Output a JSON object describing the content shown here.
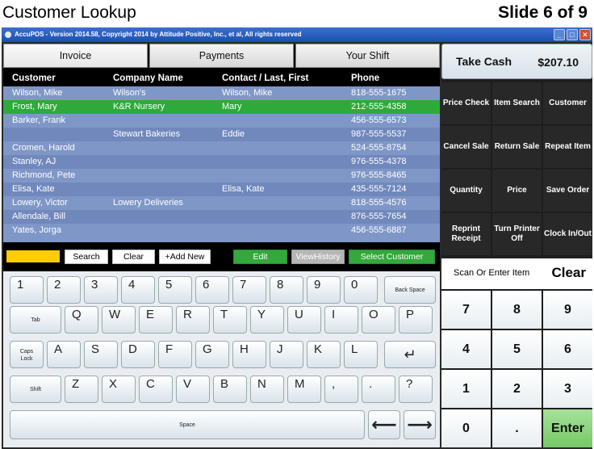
{
  "slide": {
    "title": "Customer Lookup",
    "counter": "Slide 6 of 9"
  },
  "window": {
    "title": "AccuPOS - Version 2014.58, Copyright 2014 by Attitude Positive, Inc., et al, All rights reserved",
    "minimize": "_",
    "maximize": "□",
    "close": "✕"
  },
  "tabs": [
    "Invoice",
    "Payments",
    "Your Shift"
  ],
  "table": {
    "headers": [
      "Customer",
      "Company Name",
      "Contact / Last, First",
      "Phone"
    ],
    "rows": [
      [
        "Wilson, Mike",
        "Wilson's",
        "Wilson, Mike",
        "818-555-1675"
      ],
      [
        "Frost, Mary",
        "K&R Nursery",
        "Mary",
        "212-555-4358"
      ],
      [
        "Barker, Frank",
        "",
        "",
        "456-555-6573"
      ],
      [
        "",
        "Stewart Bakeries",
        "Eddie",
        "987-555-5537"
      ],
      [
        "Cromen, Harold",
        "",
        "",
        "524-555-8754"
      ],
      [
        "Stanley, AJ",
        "",
        "",
        "976-555-4378"
      ],
      [
        "Richmond, Pete",
        "",
        "",
        "976-555-8465"
      ],
      [
        "Elisa, Kate",
        "",
        "Elisa, Kate",
        "435-555-7124"
      ],
      [
        "Lowery, Victor",
        "Lowery Deliveries",
        "",
        "818-555-4576"
      ],
      [
        "Allendale, Bill",
        "",
        "",
        "876-555-7654"
      ],
      [
        "Yates, Jorga",
        "",
        "",
        "456-555-6887"
      ]
    ],
    "selected_row": 1
  },
  "actions": {
    "search": "Search",
    "clear": "Clear",
    "add_new": "+Add New",
    "edit": "Edit",
    "view_history": "ViewHistory",
    "select_customer": "Select Customer"
  },
  "keyboard": {
    "row1": [
      "1",
      "2",
      "3",
      "4",
      "5",
      "6",
      "7",
      "8",
      "9",
      "0"
    ],
    "backspace": "Back Space",
    "tab": "Tab",
    "row2": [
      "Q",
      "W",
      "E",
      "R",
      "T",
      "Y",
      "U",
      "I",
      "O",
      "P"
    ],
    "caps": "Caps\nLock",
    "row3": [
      "A",
      "S",
      "D",
      "F",
      "G",
      "H",
      "J",
      "K",
      "L"
    ],
    "enter_icon": "return-arrow-icon",
    "shift": "Shift",
    "row4": [
      "Z",
      "X",
      "C",
      "V",
      "B",
      "N",
      "M",
      ",",
      ".",
      "?"
    ],
    "space": "Space",
    "left_icon": "arrow-left-icon",
    "right_icon": "arrow-right-icon"
  },
  "take_cash": {
    "label": "Take Cash",
    "amount": "$207.10"
  },
  "functions": [
    "Price Check",
    "Item Search",
    "Customer",
    "Cancel Sale",
    "Return Sale",
    "Repeat Item",
    "Quantity",
    "Price",
    "Save Order",
    "Reprint Receipt",
    "Turn Printer Off",
    "Clock In/Out"
  ],
  "scan": {
    "label": "Scan Or Enter Item",
    "clear": "Clear"
  },
  "numpad": [
    "7",
    "8",
    "9",
    "4",
    "5",
    "6",
    "1",
    "2",
    "3",
    "0",
    ".",
    "Enter"
  ],
  "colors": {
    "selected_row": "#2eaa3a",
    "row": "#7f97c7",
    "accent_yellow": "#ffcc00",
    "enter": "#8bd67a"
  }
}
